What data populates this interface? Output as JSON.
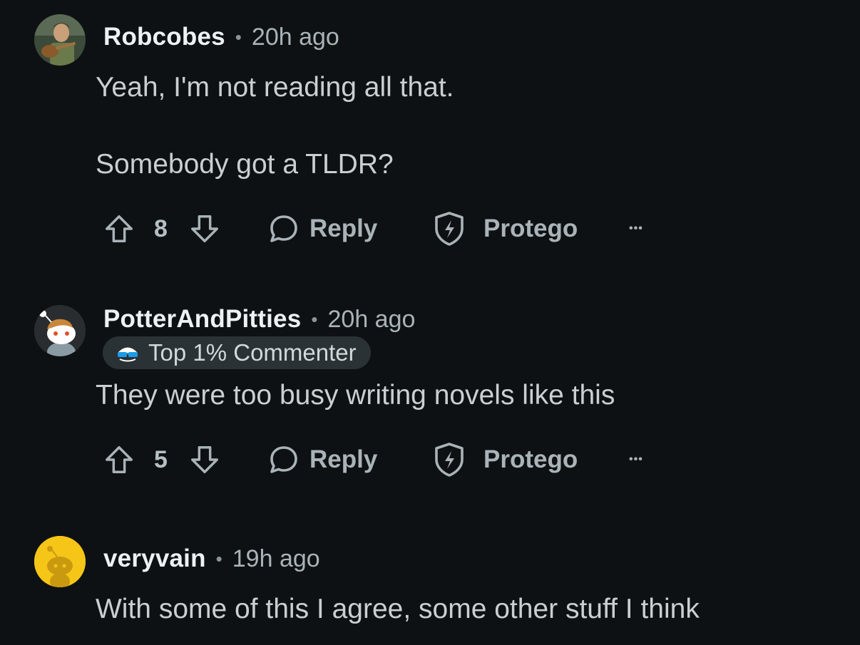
{
  "comments": [
    {
      "username": "Robcobes",
      "separator": "•",
      "time": "20h ago",
      "body_lines": [
        "Yeah, I'm not reading all that.",
        "Somebody got a TLDR?"
      ],
      "votes": "8",
      "reply_label": "Reply",
      "award_label": "Protego",
      "more_label": "•••"
    },
    {
      "username": "PotterAndPitties",
      "separator": "•",
      "time": "20h ago",
      "badge": "Top 1% Commenter",
      "body_lines": [
        "They were too busy writing novels like this"
      ],
      "votes": "5",
      "reply_label": "Reply",
      "award_label": "Protego",
      "more_label": "•••"
    },
    {
      "username": "veryvain",
      "separator": "•",
      "time": "19h ago",
      "body_lines": [
        "With some of this I agree, some other stuff I think"
      ]
    }
  ],
  "colors": {
    "background": "#0e1113",
    "username": "#eef1f3",
    "body_text": "#c9cfd2",
    "muted": "#a9b3b8",
    "badge_bg": "#2a3236",
    "avatar_yellow": "#f5c518"
  },
  "icons": {
    "upvote": "upvote-arrow-icon",
    "downvote": "downvote-arrow-icon",
    "reply": "speech-bubble-icon",
    "award": "shield-bolt-icon",
    "more": "ellipsis-icon",
    "badge": "sunglasses-icon"
  }
}
